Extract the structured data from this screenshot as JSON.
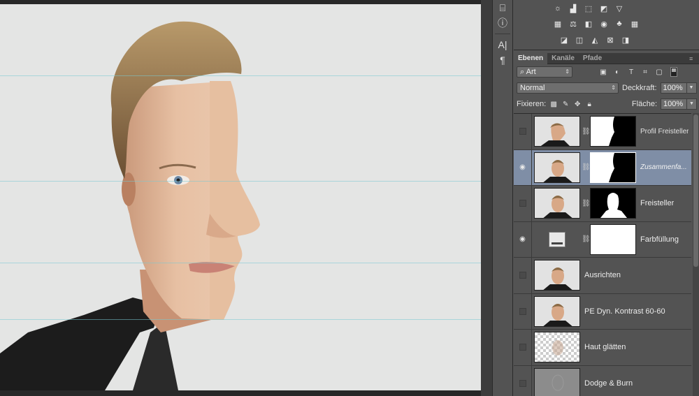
{
  "panels": {
    "tabs": [
      {
        "label": "Ebenen",
        "active": true
      },
      {
        "label": "Kanäle",
        "active": false
      },
      {
        "label": "Pfade",
        "active": false
      }
    ],
    "filter_select": "Art",
    "blend_mode": "Normal",
    "opacity_label": "Deckkraft:",
    "opacity_value": "100%",
    "lock_label": "Fixieren:",
    "fill_label": "Fläche:",
    "fill_value": "100%"
  },
  "layers": [
    {
      "name": "Profil Freisteller",
      "visible": false,
      "selected": false,
      "thumb": "photo",
      "mask": "profile"
    },
    {
      "name": "Zusammenfa...",
      "visible": true,
      "selected": true,
      "thumb": "photo",
      "mask": "profile"
    },
    {
      "name": "Freisteller",
      "visible": false,
      "selected": false,
      "thumb": "photo",
      "mask": "bust"
    },
    {
      "name": "Farbfüllung",
      "visible": true,
      "selected": false,
      "thumb": "fill",
      "mask": "white"
    },
    {
      "name": "Ausrichten",
      "visible": false,
      "selected": false,
      "thumb": "photo",
      "mask": null
    },
    {
      "name": "PE Dyn. Kontrast 60-60",
      "visible": false,
      "selected": false,
      "thumb": "photo",
      "mask": null
    },
    {
      "name": "Haut glätten",
      "visible": false,
      "selected": false,
      "thumb": "checker",
      "mask": null
    },
    {
      "name": "Dodge & Burn",
      "visible": false,
      "selected": false,
      "thumb": "gray",
      "mask": null
    }
  ],
  "colors": {
    "workspace": "#535353",
    "canvas_bg": "#e4e5e4",
    "selected_layer": "#7f8ea6"
  }
}
